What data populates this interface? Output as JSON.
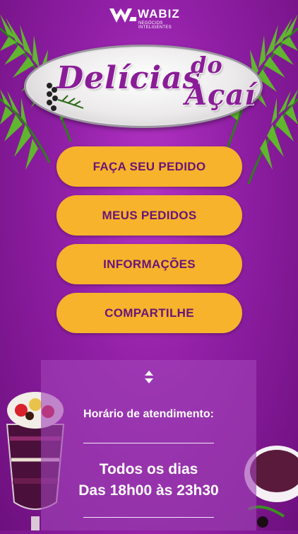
{
  "brand": {
    "name": "WABIZ",
    "tagline": "NEGÓCIOS INTELIGENTES"
  },
  "logo": {
    "word1": "Delícias",
    "word2": "do",
    "word3": "Açaí"
  },
  "menu": {
    "order_label": "FAÇA SEU PEDIDO",
    "my_orders_label": "MEUS PEDIDOS",
    "info_label": "INFORMAÇÕES",
    "share_label": "COMPARTILHE"
  },
  "hours": {
    "label": "Horário de atendimento:",
    "days": "Todos os dias",
    "time": "Das 18h00 às 23h30"
  },
  "colors": {
    "background": "#8e1ea3",
    "button": "#f6b32b",
    "button_text": "#6a1478",
    "logo_text": "#8a1d97"
  },
  "icons": {
    "brand": "wabiz-logo-icon",
    "toggle": "up-down-arrows-icon"
  }
}
